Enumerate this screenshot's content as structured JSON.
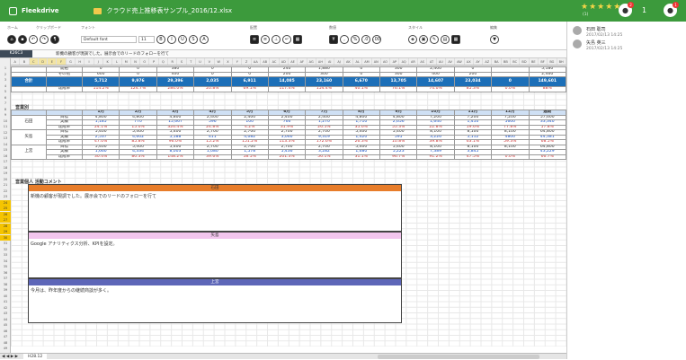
{
  "app": {
    "name": "Fleekdrive",
    "file_name": "クラウド売上推移表サンプル_2016/12.xlsx",
    "rating_sub": "(1)",
    "notifications": "1",
    "notif_badge": "2",
    "profile_badge": "1"
  },
  "ribbon": {
    "groups": [
      "ホーム",
      "クリップボード",
      "フォント",
      "配置",
      "数値",
      "スタイル",
      "編集"
    ],
    "font_name": "Default font",
    "font_size": "11"
  },
  "formula_bar": {
    "cell_ref": "K26C3",
    "formula": "新機の顧客が現調でした。展示会でのリードのフォローを行て"
  },
  "columns": [
    "A",
    "B",
    "C",
    "D",
    "E",
    "F",
    "G",
    "H",
    "I",
    "J",
    "K",
    "L",
    "M",
    "N",
    "O",
    "P",
    "Q",
    "R",
    "S",
    "T",
    "U",
    "V",
    "W",
    "X",
    "Y",
    "Z",
    "AA",
    "AB",
    "AC",
    "AD",
    "AE",
    "AF",
    "AG",
    "AH",
    "AI",
    "AJ",
    "AK",
    "AL",
    "AM",
    "AN",
    "AO",
    "AP",
    "AQ",
    "AR",
    "AS",
    "AT",
    "AU",
    "AV",
    "AW",
    "AX",
    "AY",
    "AZ",
    "BA",
    "BB",
    "BC",
    "BD",
    "BE",
    "BF",
    "BG",
    "BH"
  ],
  "rows": [
    "1",
    "2",
    "3",
    "4",
    "5",
    "6",
    "7",
    "8",
    "9",
    "10",
    "11",
    "12",
    "13",
    "14",
    "15",
    "16",
    "17",
    "18",
    "19",
    "20",
    "21",
    "22",
    "23",
    "24",
    "25",
    "26",
    "27",
    "28",
    "29",
    "30",
    "31",
    "32",
    "33",
    "34",
    "35",
    "36",
    "37",
    "38",
    "39",
    "40",
    "41",
    "42",
    "43",
    "44",
    "45",
    "46",
    "47",
    "48",
    "49",
    "50"
  ],
  "top_table": {
    "rows": [
      [
        "",
        "開拓",
        "0",
        "0",
        "380",
        "0",
        "0",
        "240",
        "1,880",
        "0",
        "300",
        "2,400",
        "0",
        "",
        "5,180"
      ],
      [
        "",
        "その他",
        "600",
        "0",
        "400",
        "0",
        "0",
        "200",
        "300",
        "0",
        "300",
        "400",
        "200",
        "",
        "2,460"
      ]
    ],
    "total": [
      "合計",
      "",
      "5,712",
      "9,976",
      "29,396",
      "2,035",
      "6,911",
      "14,085",
      "23,160",
      "6,670",
      "13,705",
      "14,607",
      "23,034",
      "0",
      "149,601"
    ],
    "rate": [
      "",
      "達成率",
      "114.2%",
      "124.7%",
      "284.0%",
      "20.8%",
      "69.1%",
      "117.4%",
      "154.4%",
      "40.1%",
      "76.1%",
      "74.0%",
      "85.3%",
      "0.0%",
      "88%"
    ]
  },
  "sales_table": {
    "title": "営業別",
    "header": [
      "",
      "",
      "1月",
      "2月",
      "3月",
      "4月",
      "5月",
      "6月",
      "7月",
      "8月",
      "9月",
      "10月",
      "11月",
      "12月",
      "通期"
    ],
    "people": [
      {
        "name": "石田",
        "rows": [
          [
            "目標",
            "4,800",
            "4,800",
            "4,800",
            "2,400",
            "2,400",
            "2,400",
            "2,400",
            "4,800",
            "4,800",
            "7,200",
            "7,200",
            "7,200",
            "57,600"
          ],
          [
            "実績",
            "1,185",
            "770",
            "15,667",
            "596",
            "100",
            "766",
            "1,270",
            "1,710",
            "2,656",
            "1,640",
            "1,410",
            "5600",
            "33,340"
          ],
          [
            "達成率",
            "24.1%",
            "15.0%",
            "326.4%",
            "24.8%",
            "4.2%",
            "31.9%",
            "26.5%",
            "35.6%",
            "55.3%",
            "22.8%",
            "19.6%",
            "77.8%",
            "57.8%"
          ]
        ]
      },
      {
        "name": "矢島",
        "rows": [
          [
            "目標",
            "5,400",
            "5,400",
            "5,400",
            "2,700",
            "2,700",
            "2,700",
            "2,700",
            "5,400",
            "5,400",
            "8,100",
            "8,100",
            "8,100",
            "64,800"
          ],
          [
            "実績",
            "2,537",
            "4,602",
            "5,188",
            "411",
            "4,082",
            "3,060",
            "9,319",
            "1,420",
            "595",
            "3,226",
            "5,112",
            "4800",
            "44,381"
          ],
          [
            "達成率",
            "47.0%",
            "85.8%",
            "96.0%",
            "15.2%",
            "151.2%",
            "113.3%",
            "172.6%",
            "26.3%",
            "10.8%",
            "39.8%",
            "63.1%",
            "59.3%",
            "68.5%"
          ]
        ]
      },
      {
        "name": "上宮",
        "rows": [
          [
            "目標",
            "5,400",
            "5,400",
            "5,400",
            "2,700",
            "2,700",
            "2,700",
            "2,700",
            "5,400",
            "5,400",
            "8,100",
            "8,100",
            "8,100",
            "64,800"
          ],
          [
            "実績",
            "1,660",
            "4,334",
            "8,003",
            "1,080",
            "1,578",
            "5,436",
            "3,282",
            "1,680",
            "5,223",
            "7,389",
            "3,845",
            "",
            "43,229"
          ],
          [
            "達成率",
            "30.4%",
            "80.3%",
            "148.2%",
            "39.6%",
            "58.5%",
            "201.3%",
            "56.1%",
            "31.1%",
            "96.7%",
            "91.2%",
            "47.5%",
            "0.0%",
            "66.7%"
          ]
        ]
      }
    ]
  },
  "comments_section": {
    "title": "営業個人 活動コメント",
    "boxes": [
      {
        "name": "石田",
        "text": "新機の顧客が現調でした。展示会でのリードのフォローを行て",
        "color": "#e87d2a"
      },
      {
        "name": "矢島",
        "text": "Google アナリティクス分析、KPIを設定。",
        "color": "#f3c6ee"
      },
      {
        "name": "上宮",
        "text": "今月は、昨年度からの継続商談が多く。",
        "color": "#5d66b8"
      }
    ]
  },
  "sheet_tabs": {
    "current": "H28.12",
    "arrows": "◀ ◀ ▶ ▶"
  },
  "side_comments": [
    {
      "name": "石田 聡司",
      "date": "2017/02/13 14:25"
    },
    {
      "name": "矢島 英三",
      "date": "2017/02/13 14:25"
    }
  ],
  "colors": {
    "header_green": "#3c9a3c",
    "total_blue": "#1c6fb8",
    "selected_yellow": "#f5c400"
  }
}
